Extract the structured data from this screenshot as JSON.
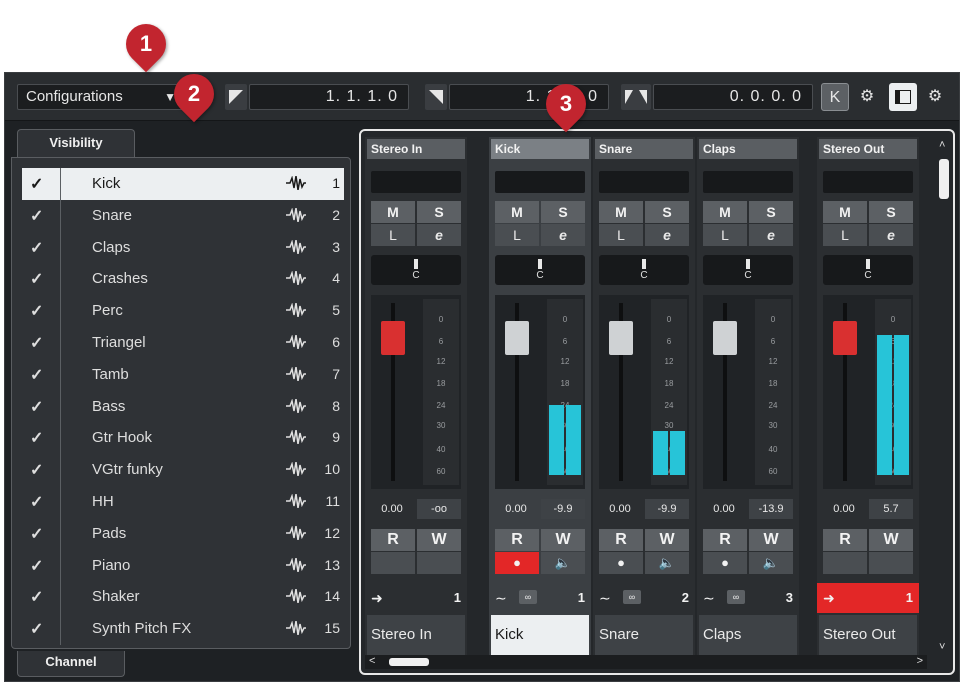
{
  "callouts": [
    "1",
    "2",
    "3"
  ],
  "toolbar": {
    "config_label": "Configurations",
    "field1": "1. 1. 1.   0",
    "field2": "1.  1.  1.   0",
    "field3": "0. 0. 0.   0",
    "k_button": "K",
    "gear": "⚙",
    "panel_toggle": "▭",
    "settings": "⚙"
  },
  "tabs": {
    "visibility": "Visibility",
    "channel": "Channel"
  },
  "tracks": [
    {
      "name": "Kick",
      "idx": "1"
    },
    {
      "name": "Snare",
      "idx": "2"
    },
    {
      "name": "Claps",
      "idx": "3"
    },
    {
      "name": "Crashes",
      "idx": "4"
    },
    {
      "name": "Perc",
      "idx": "5"
    },
    {
      "name": "Triangel",
      "idx": "6"
    },
    {
      "name": "Tamb",
      "idx": "7"
    },
    {
      "name": "Bass",
      "idx": "8"
    },
    {
      "name": "Gtr Hook",
      "idx": "9"
    },
    {
      "name": "VGtr funky",
      "idx": "10"
    },
    {
      "name": "HH",
      "idx": "11"
    },
    {
      "name": "Pads",
      "idx": "12"
    },
    {
      "name": "Piano",
      "idx": "13"
    },
    {
      "name": "Shaker",
      "idx": "14"
    },
    {
      "name": "Synth Pitch FX",
      "idx": "15"
    }
  ],
  "track_check": "✓",
  "strips": [
    {
      "name": "Stereo In",
      "label": "Stereo In",
      "m": "M",
      "s": "S",
      "l": "L",
      "e": "e",
      "pan": "C",
      "vol": "0.00",
      "peak": "-oo",
      "r": "R",
      "w": "W",
      "route": "1"
    },
    {
      "name": "Kick",
      "label": "Kick",
      "m": "M",
      "s": "S",
      "l": "L",
      "e": "e",
      "pan": "C",
      "vol": "0.00",
      "peak": "-9.9",
      "r": "R",
      "w": "W",
      "route": "1"
    },
    {
      "name": "Snare",
      "label": "Snare",
      "m": "M",
      "s": "S",
      "l": "L",
      "e": "e",
      "pan": "C",
      "vol": "0.00",
      "peak": "-9.9",
      "r": "R",
      "w": "W",
      "route": "2"
    },
    {
      "name": "Claps",
      "label": "Claps",
      "m": "M",
      "s": "S",
      "l": "L",
      "e": "e",
      "pan": "C",
      "vol": "0.00",
      "peak": "-13.9",
      "r": "R",
      "w": "W",
      "route": "3"
    },
    {
      "name": "Stereo Out",
      "label": "Stereo Out",
      "m": "M",
      "s": "S",
      "l": "L",
      "e": "e",
      "pan": "C",
      "vol": "0.00",
      "peak": "5.7",
      "r": "R",
      "w": "W",
      "route": "1"
    }
  ],
  "meter_scale": [
    "0",
    "6",
    "12",
    "18",
    "24",
    "30",
    "40",
    "60"
  ],
  "colors": {
    "meter": "#27c4d8",
    "fader_red": "#d93030",
    "fader_gray": "#cfd2d4",
    "output_red": "#e32727",
    "callout": "#c2252f"
  }
}
